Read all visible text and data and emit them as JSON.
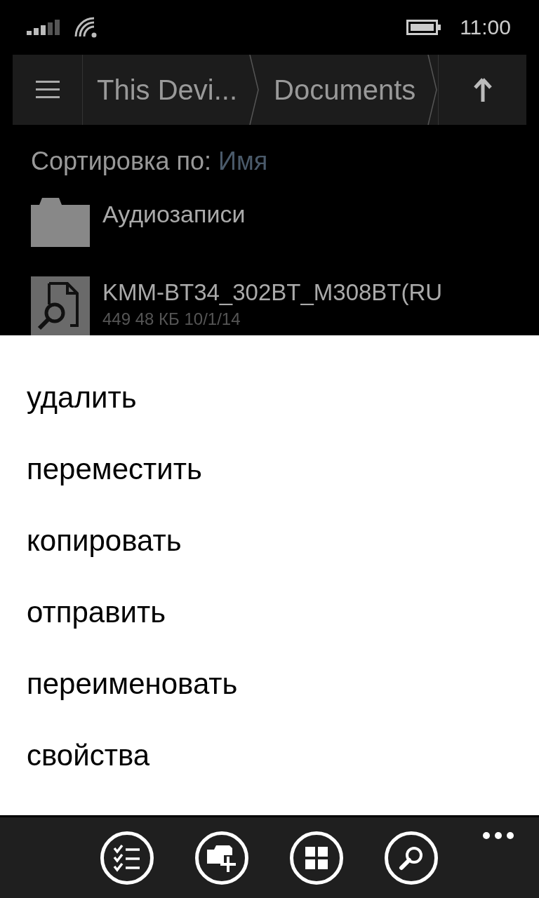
{
  "status_bar": {
    "time": "11:00"
  },
  "breadcrumb": {
    "items": [
      {
        "label": "This Devi..."
      },
      {
        "label": "Documents"
      }
    ]
  },
  "sort": {
    "label": "Сортировка по:",
    "value": "Имя"
  },
  "files": [
    {
      "kind": "folder",
      "name": "Аудиозаписи"
    },
    {
      "kind": "document",
      "name": "KMM-BT34_302BT_M308BT(RU",
      "details": "449 48 КБ 10/1/14"
    }
  ],
  "context_menu": {
    "items": [
      "удалить",
      "переместить",
      "копировать",
      "отправить",
      "переименовать",
      "свойства"
    ]
  },
  "app_bar": {
    "buttons": [
      {
        "kind": "select"
      },
      {
        "kind": "new-folder"
      },
      {
        "kind": "tiles"
      },
      {
        "kind": "search"
      }
    ]
  }
}
